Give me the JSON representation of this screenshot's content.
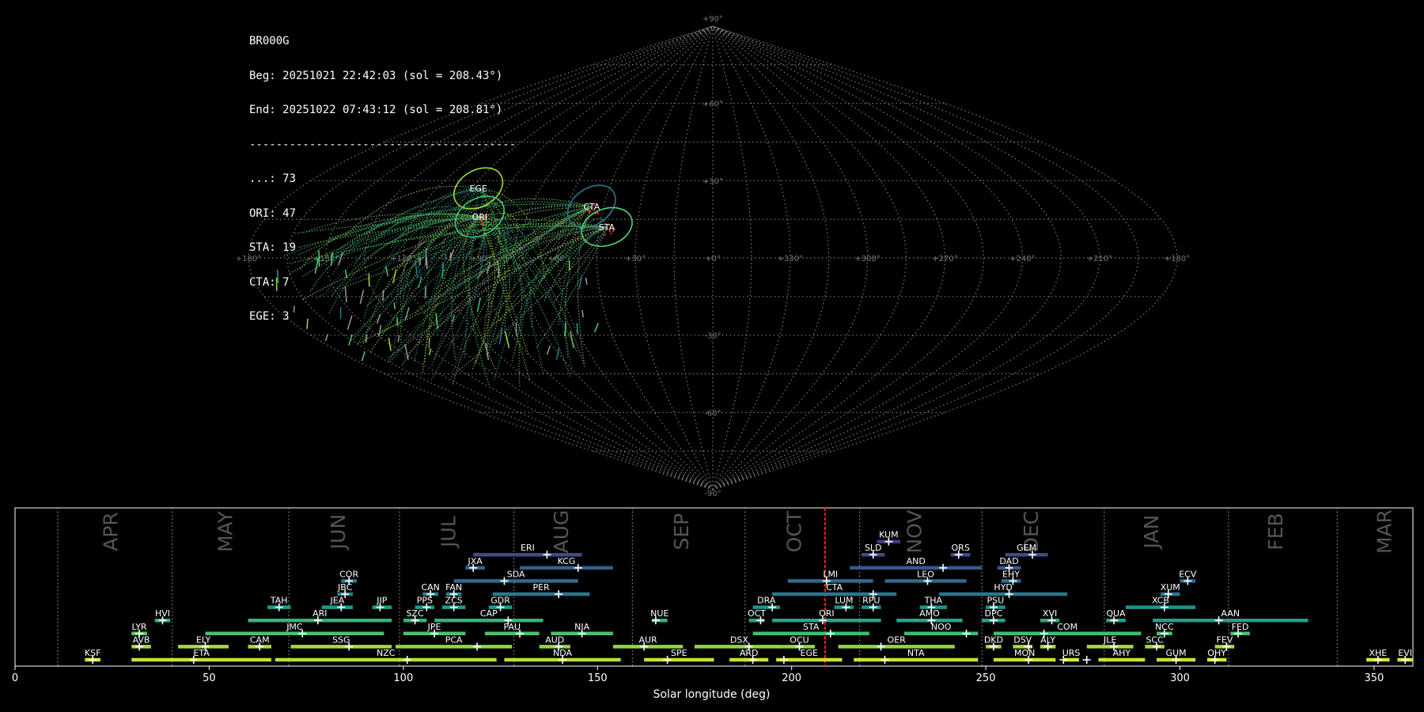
{
  "info": {
    "station": "BR000G",
    "begin": "Beg: 20251021 22:42:03 (sol = 208.43°)",
    "end": "End: 20251022 07:43:12 (sol = 208.81°)",
    "separator": "----------------------------------------",
    "counts": [
      {
        "label": "...: 73"
      },
      {
        "label": "ORI: 47"
      },
      {
        "label": "STA: 19"
      },
      {
        "label": "CTA: 7"
      },
      {
        "label": "EGE: 3"
      }
    ]
  },
  "chart_data": [
    {
      "type": "scatter",
      "projection": "sinusoidal sky map",
      "lon_ticks": [
        "+180°",
        "+150°",
        "+120°",
        "+90°",
        "+60°",
        "+30°",
        "+0°",
        "+330°",
        "+300°",
        "+270°",
        "+240°",
        "+210°",
        "+180°"
      ],
      "lat_ticks": [
        "+90°",
        "+60°",
        "+30°",
        "-30°",
        "-60°",
        "-90°"
      ],
      "radiants": [
        {
          "name": "EGE",
          "lon": 102,
          "lat": 27,
          "color": "#a0d940"
        },
        {
          "name": "ORI",
          "lon": 94,
          "lat": 16,
          "color": "#3fc87a"
        },
        {
          "name": "CTA",
          "lon": 50,
          "lat": 20,
          "color": "#2a788e"
        },
        {
          "name": "STA",
          "lon": 42,
          "lat": 12,
          "color": "#4fd37a"
        }
      ]
    },
    {
      "type": "timeline",
      "xlabel": "Solar longitude (deg)",
      "xlim": [
        0,
        360
      ],
      "x_ticks": [
        0,
        50,
        100,
        150,
        200,
        250,
        300,
        350
      ],
      "current_sol": 208.6,
      "months": [
        {
          "name": "APR",
          "x": 25,
          "boundary": 11
        },
        {
          "name": "MAY",
          "x": 54.5,
          "boundary": 40.5
        },
        {
          "name": "JUN",
          "x": 83.5,
          "boundary": 70.5
        },
        {
          "name": "JUL",
          "x": 112,
          "boundary": 99
        },
        {
          "name": "AUG",
          "x": 141,
          "boundary": 128.5
        },
        {
          "name": "SEP",
          "x": 172,
          "boundary": 159
        },
        {
          "name": "OCT",
          "x": 201,
          "boundary": 188
        },
        {
          "name": "NOV",
          "x": 232,
          "boundary": 217.5
        },
        {
          "name": "DEC",
          "x": 262,
          "boundary": 249
        },
        {
          "name": "JAN",
          "x": 293,
          "boundary": 280.5
        },
        {
          "name": "FEB",
          "x": 325,
          "boundary": 312.5
        },
        {
          "name": "MAR",
          "x": 353,
          "boundary": 340.5
        }
      ],
      "showers": [
        {
          "name": "KSF",
          "start": 18,
          "end": 22,
          "peak": 20,
          "row": 0,
          "color": "#d9e33a"
        },
        {
          "name": "ETA",
          "start": 30,
          "end": 66,
          "peak": 46,
          "row": 0,
          "color": "#c7e03a"
        },
        {
          "name": "NZC",
          "start": 67,
          "end": 124,
          "peak": 101,
          "row": 0,
          "color": "#b5de3c"
        },
        {
          "name": "NDA",
          "start": 126,
          "end": 156,
          "peak": 141,
          "row": 0,
          "color": "#b5de3c"
        },
        {
          "name": "SPE",
          "start": 162,
          "end": 180,
          "peak": 168,
          "row": 0,
          "color": "#c7e03a"
        },
        {
          "name": "ARD",
          "start": 184,
          "end": 194,
          "peak": 190,
          "row": 0,
          "color": "#c7e03a"
        },
        {
          "name": "EGE",
          "start": 196,
          "end": 213,
          "peak": 198,
          "row": 0,
          "color": "#c7e03a"
        },
        {
          "name": "NTA",
          "start": 216,
          "end": 248,
          "peak": 224,
          "row": 0,
          "color": "#c7e03a"
        },
        {
          "name": "MON",
          "start": 252,
          "end": 268,
          "peak": 261,
          "row": 0,
          "color": "#c7e03a"
        },
        {
          "name": "URS",
          "start": 270,
          "end": 274,
          "peak": 270,
          "row": 0,
          "color": "#d9e33a"
        },
        {
          "name": "AHY",
          "start": 279,
          "end": 291,
          "peak": 276,
          "row": 0,
          "color": "#c7e03a"
        },
        {
          "name": "GUM",
          "start": 294,
          "end": 304,
          "peak": 299,
          "row": 0,
          "color": "#c7e03a"
        },
        {
          "name": "OHY",
          "start": 307,
          "end": 312,
          "peak": 309,
          "row": 0,
          "color": "#d9e33a"
        },
        {
          "name": "XHE",
          "start": 348,
          "end": 354,
          "peak": 351,
          "row": 0,
          "color": "#d9e33a"
        },
        {
          "name": "EVI",
          "start": 356,
          "end": 360,
          "peak": 358,
          "row": 0,
          "color": "#d9e33a"
        },
        {
          "name": "AVB",
          "start": 30,
          "end": 35,
          "peak": 32,
          "row": 1,
          "color": "#a8db34"
        },
        {
          "name": "ELY",
          "start": 42,
          "end": 55,
          "peak": 49,
          "row": 1,
          "color": "#a8db34"
        },
        {
          "name": "CAM",
          "start": 60,
          "end": 66,
          "peak": 63,
          "row": 1,
          "color": "#a8db34"
        },
        {
          "name": "SSG",
          "start": 71,
          "end": 97,
          "peak": 86,
          "row": 1,
          "color": "#a8db34"
        },
        {
          "name": "PCA",
          "start": 98,
          "end": 128,
          "peak": 119,
          "row": 1,
          "color": "#8fd744"
        },
        {
          "name": "AUD",
          "start": 135,
          "end": 143,
          "peak": 140,
          "row": 1,
          "color": "#8fd744"
        },
        {
          "name": "AUR",
          "start": 154,
          "end": 172,
          "peak": 162,
          "row": 1,
          "color": "#8fd744"
        },
        {
          "name": "DSX",
          "start": 175,
          "end": 198,
          "peak": 189,
          "row": 1,
          "color": "#8fd744"
        },
        {
          "name": "OCU",
          "start": 198,
          "end": 206,
          "peak": 202,
          "row": 1,
          "color": "#8fd744"
        },
        {
          "name": "OER",
          "start": 212,
          "end": 242,
          "peak": 223,
          "row": 1,
          "color": "#8fd744"
        },
        {
          "name": "DKD",
          "start": 250,
          "end": 254,
          "peak": 252,
          "row": 1,
          "color": "#a8db34"
        },
        {
          "name": "DSV",
          "start": 257,
          "end": 262,
          "peak": 261,
          "row": 1,
          "color": "#a8db34"
        },
        {
          "name": "ALY",
          "start": 264,
          "end": 268,
          "peak": 266,
          "row": 1,
          "color": "#a8db34"
        },
        {
          "name": "JLE",
          "start": 276,
          "end": 288,
          "peak": 283,
          "row": 1,
          "color": "#a8db34"
        },
        {
          "name": "SCC",
          "start": 291,
          "end": 296,
          "peak": 294,
          "row": 1,
          "color": "#a8db34"
        },
        {
          "name": "FEV",
          "start": 309,
          "end": 314,
          "peak": 312,
          "row": 1,
          "color": "#a8db34"
        },
        {
          "name": "LYR",
          "start": 30,
          "end": 34,
          "peak": 32,
          "row": 2,
          "color": "#5ec962"
        },
        {
          "name": "JMC",
          "start": 49,
          "end": 95,
          "peak": 74,
          "row": 2,
          "color": "#4ac16d"
        },
        {
          "name": "JPE",
          "start": 100,
          "end": 116,
          "peak": 108,
          "row": 2,
          "color": "#4ac16d"
        },
        {
          "name": "PAU",
          "start": 121,
          "end": 135,
          "peak": 130,
          "row": 2,
          "color": "#4ac16d"
        },
        {
          "name": "NIA",
          "start": 138,
          "end": 154,
          "peak": 146,
          "row": 2,
          "color": "#4ac16d"
        },
        {
          "name": "STA",
          "start": 190,
          "end": 220,
          "peak": 210,
          "row": 2,
          "color": "#3dbc74"
        },
        {
          "name": "NOO",
          "start": 229,
          "end": 248,
          "peak": 245,
          "row": 2,
          "color": "#3dbc74"
        },
        {
          "name": "COM",
          "start": 252,
          "end": 290,
          "peak": 265,
          "row": 2,
          "color": "#3dbc74"
        },
        {
          "name": "NCC",
          "start": 294,
          "end": 298,
          "peak": 296,
          "row": 2,
          "color": "#4ac16d"
        },
        {
          "name": "FED",
          "start": 313,
          "end": 318,
          "peak": 315,
          "row": 2,
          "color": "#4ac16d"
        },
        {
          "name": "HVI",
          "start": 36,
          "end": 40,
          "peak": 38,
          "row": 3,
          "color": "#2fb47c"
        },
        {
          "name": "ARI",
          "start": 60,
          "end": 97,
          "peak": 78,
          "row": 3,
          "color": "#2fb47c"
        },
        {
          "name": "SZC",
          "start": 100,
          "end": 106,
          "peak": 103,
          "row": 3,
          "color": "#2fb47c"
        },
        {
          "name": "CAP",
          "start": 108,
          "end": 136,
          "peak": 127,
          "row": 3,
          "color": "#2fb47c"
        },
        {
          "name": "NUE",
          "start": 164,
          "end": 168,
          "peak": 165,
          "row": 3,
          "color": "#2fb47c"
        },
        {
          "name": "OCT",
          "start": 189,
          "end": 193,
          "peak": 192,
          "row": 3,
          "color": "#22a785"
        },
        {
          "name": "ORI",
          "start": 195,
          "end": 223,
          "peak": 208,
          "row": 3,
          "color": "#22a785"
        },
        {
          "name": "AMO",
          "start": 227,
          "end": 244,
          "peak": 236,
          "row": 3,
          "color": "#22a785"
        },
        {
          "name": "DPC",
          "start": 249,
          "end": 255,
          "peak": 252,
          "row": 3,
          "color": "#22a785"
        },
        {
          "name": "XVI",
          "start": 264,
          "end": 269,
          "peak": 267,
          "row": 3,
          "color": "#22a785"
        },
        {
          "name": "QUA",
          "start": 281,
          "end": 286,
          "peak": 283,
          "row": 3,
          "color": "#22a785"
        },
        {
          "name": "AAN",
          "start": 293,
          "end": 333,
          "peak": 310,
          "row": 3,
          "color": "#1fa187"
        },
        {
          "name": "TAH",
          "start": 65,
          "end": 71,
          "peak": 68,
          "row": 4,
          "color": "#1f9a8a"
        },
        {
          "name": "JEA",
          "start": 79,
          "end": 87,
          "peak": 84,
          "row": 4,
          "color": "#1f9a8a"
        },
        {
          "name": "JIP",
          "start": 92,
          "end": 97,
          "peak": 94,
          "row": 4,
          "color": "#1f9a8a"
        },
        {
          "name": "PPS",
          "start": 103,
          "end": 108,
          "peak": 106,
          "row": 4,
          "color": "#1f9a8a"
        },
        {
          "name": "ZCS",
          "start": 110,
          "end": 116,
          "peak": 113,
          "row": 4,
          "color": "#1f9a8a"
        },
        {
          "name": "GDR",
          "start": 122,
          "end": 128,
          "peak": 125,
          "row": 4,
          "color": "#1f9a8a"
        },
        {
          "name": "DRA",
          "start": 190,
          "end": 197,
          "peak": 195,
          "row": 4,
          "color": "#21918c"
        },
        {
          "name": "LUM",
          "start": 211,
          "end": 216,
          "peak": 214,
          "row": 4,
          "color": "#21918c"
        },
        {
          "name": "RPU",
          "start": 218,
          "end": 223,
          "peak": 221,
          "row": 4,
          "color": "#21918c"
        },
        {
          "name": "THA",
          "start": 233,
          "end": 240,
          "peak": 236,
          "row": 4,
          "color": "#21918c"
        },
        {
          "name": "PSU",
          "start": 250,
          "end": 255,
          "peak": 252,
          "row": 4,
          "color": "#21918c"
        },
        {
          "name": "XCB",
          "start": 286,
          "end": 304,
          "peak": 296,
          "row": 4,
          "color": "#21918c"
        },
        {
          "name": "JBC",
          "start": 83,
          "end": 87,
          "peak": 85,
          "row": 5,
          "color": "#26818e"
        },
        {
          "name": "CAN",
          "start": 105,
          "end": 109,
          "peak": 107,
          "row": 5,
          "color": "#26818e"
        },
        {
          "name": "FAN",
          "start": 111,
          "end": 115,
          "peak": 113,
          "row": 5,
          "color": "#26818e"
        },
        {
          "name": "PER",
          "start": 123,
          "end": 148,
          "peak": 140,
          "row": 5,
          "color": "#2a788e"
        },
        {
          "name": "CTA",
          "start": 195,
          "end": 227,
          "peak": 221,
          "row": 5,
          "color": "#2a788e"
        },
        {
          "name": "HYD",
          "start": 238,
          "end": 271,
          "peak": 256,
          "row": 5,
          "color": "#2a788e"
        },
        {
          "name": "XUM",
          "start": 295,
          "end": 300,
          "peak": 297,
          "row": 5,
          "color": "#2a788e"
        },
        {
          "name": "COR",
          "start": 84,
          "end": 88,
          "peak": 86,
          "row": 6,
          "color": "#2c728e"
        },
        {
          "name": "SDA",
          "start": 113,
          "end": 145,
          "peak": 126,
          "row": 6,
          "color": "#2f6b8e"
        },
        {
          "name": "LMI",
          "start": 199,
          "end": 221,
          "peak": 209,
          "row": 6,
          "color": "#2f6b8e"
        },
        {
          "name": "LEO",
          "start": 224,
          "end": 245,
          "peak": 235,
          "row": 6,
          "color": "#2f6b8e"
        },
        {
          "name": "EHY",
          "start": 254,
          "end": 259,
          "peak": 257,
          "row": 6,
          "color": "#2f6b8e"
        },
        {
          "name": "ECV",
          "start": 300,
          "end": 304,
          "peak": 302,
          "row": 6,
          "color": "#2f6b8e"
        },
        {
          "name": "JXA",
          "start": 116,
          "end": 121,
          "peak": 118,
          "row": 7,
          "color": "#33638d"
        },
        {
          "name": "KCG",
          "start": 130,
          "end": 154,
          "peak": 145,
          "row": 7,
          "color": "#355f8d"
        },
        {
          "name": "AND",
          "start": 215,
          "end": 249,
          "peak": 239,
          "row": 7,
          "color": "#39568c"
        },
        {
          "name": "DAD",
          "start": 253,
          "end": 259,
          "peak": 256,
          "row": 7,
          "color": "#39568c"
        },
        {
          "name": "ERI",
          "start": 118,
          "end": 146,
          "peak": 137,
          "row": 8,
          "color": "#3e4a89"
        },
        {
          "name": "SLD",
          "start": 218,
          "end": 224,
          "peak": 221,
          "row": 8,
          "color": "#3e4a89"
        },
        {
          "name": "ORS",
          "start": 241,
          "end": 246,
          "peak": 243,
          "row": 8,
          "color": "#3e4a89"
        },
        {
          "name": "GEM",
          "start": 255,
          "end": 266,
          "peak": 262,
          "row": 8,
          "color": "#3e4a89"
        },
        {
          "name": "KUM",
          "start": 222,
          "end": 228,
          "peak": 225,
          "row": 9,
          "color": "#443983"
        }
      ]
    }
  ]
}
